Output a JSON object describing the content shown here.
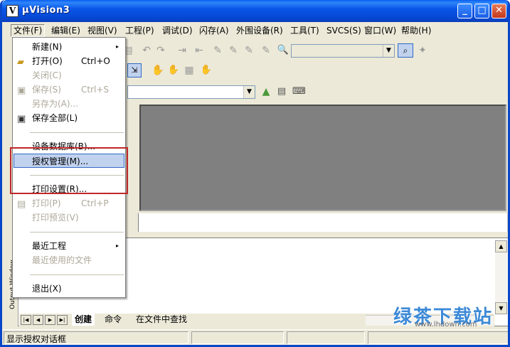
{
  "window": {
    "title": "µVision3",
    "icon_label": "V"
  },
  "menubar": [
    {
      "label": "文件(F)"
    },
    {
      "label": "编辑(E)"
    },
    {
      "label": "视图(V)"
    },
    {
      "label": "工程(P)"
    },
    {
      "label": "调试(D)"
    },
    {
      "label": "闪存(A)"
    },
    {
      "label": "外围设备(R)"
    },
    {
      "label": "工具(T)"
    },
    {
      "label": "SVCS(S)"
    },
    {
      "label": "窗口(W)"
    },
    {
      "label": "帮助(H)"
    }
  ],
  "file_menu": {
    "items": [
      {
        "label": "新建(N)",
        "shortcut": "",
        "submenu": "▸"
      },
      {
        "label": "打开(O)",
        "shortcut": "Ctrl+O"
      },
      {
        "label": "关闭(C)",
        "shortcut": ""
      },
      {
        "label": "保存(S)",
        "shortcut": "Ctrl+S"
      },
      {
        "label": "另存为(A)...",
        "shortcut": ""
      },
      {
        "label": "保存全部(L)",
        "shortcut": ""
      },
      {
        "label": "设备数据库(B)...",
        "shortcut": ""
      },
      {
        "label": "授权管理(M)...",
        "shortcut": ""
      },
      {
        "label": "打印设置(R)...",
        "shortcut": ""
      },
      {
        "label": "打印(P)",
        "shortcut": "Ctrl+P"
      },
      {
        "label": "打印预览(V)",
        "shortcut": ""
      },
      {
        "label": "最近工程",
        "shortcut": "",
        "submenu": "▸"
      },
      {
        "label": "最近使用的文件",
        "shortcut": ""
      },
      {
        "label": "退出(X)",
        "shortcut": ""
      }
    ]
  },
  "output": {
    "side_label": "Output Window",
    "tabs": [
      {
        "label": "创建"
      },
      {
        "label": "命令"
      },
      {
        "label": "在文件中查找"
      }
    ]
  },
  "statusbar": {
    "text": "显示授权对话框"
  },
  "watermark": {
    "text": "绿茶下载站",
    "url": "www.lhdown.com"
  },
  "colors": {
    "title_blue": "#0a56e8",
    "highlight_red": "#c0282a",
    "selected_bg": "#c1d2ee"
  }
}
